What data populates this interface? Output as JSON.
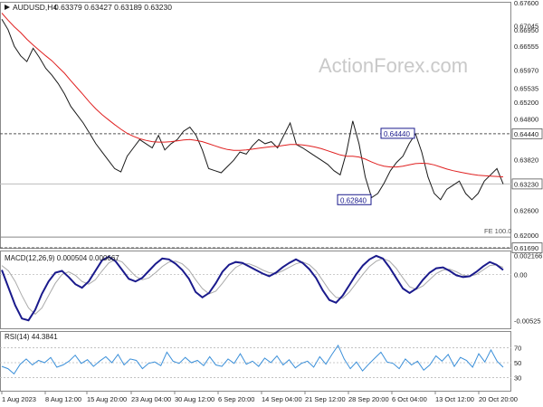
{
  "chart_data": {
    "type": "line",
    "symbol": "AUDUSD,H4",
    "ohlc_header": [
      "0.63379",
      "0.63427",
      "0.63189",
      "0.63230"
    ],
    "watermark": "ActionForex.com",
    "x_tick_labels": [
      "1 Aug 2023",
      "8 Aug 12:00",
      "15 Aug 20:00",
      "23 Aug 04:00",
      "30 Aug 12:00",
      "6 Sep 20:00",
      "14 Sep 04:00",
      "21 Sep 12:00",
      "28 Sep 20:00",
      "6 Oct 04:00",
      "13 Oct 12:00",
      "20 Oct 20:00"
    ],
    "price_panel": {
      "ylim": [
        0.6169,
        0.676
      ],
      "y_tick_labels": [
        "0.67600",
        "0.67045",
        "0.66950",
        "0.66555",
        "0.65970",
        "0.65535",
        "0.65200",
        "0.64800",
        "0.64440",
        "0.63820",
        "0.63230",
        "0.62600",
        "0.62000",
        "0.61690"
      ],
      "price_series_values": [
        0.672,
        0.6695,
        0.6655,
        0.6632,
        0.6618,
        0.665,
        0.6628,
        0.6602,
        0.6585,
        0.6565,
        0.654,
        0.651,
        0.649,
        0.647,
        0.6445,
        0.642,
        0.64,
        0.638,
        0.636,
        0.6352,
        0.639,
        0.641,
        0.643,
        0.642,
        0.641,
        0.644,
        0.6405,
        0.642,
        0.643,
        0.645,
        0.646,
        0.644,
        0.6405,
        0.636,
        0.6355,
        0.635,
        0.6365,
        0.638,
        0.64,
        0.6395,
        0.6415,
        0.643,
        0.642,
        0.6425,
        0.641,
        0.644,
        0.647,
        0.6418,
        0.641,
        0.64,
        0.639,
        0.638,
        0.637,
        0.6355,
        0.6345,
        0.64,
        0.6475,
        0.642,
        0.634,
        0.629,
        0.63,
        0.6325,
        0.6355,
        0.6375,
        0.639,
        0.642,
        0.6444,
        0.64,
        0.634,
        0.63,
        0.6285,
        0.631,
        0.632,
        0.633,
        0.63,
        0.6285,
        0.63,
        0.633,
        0.6345,
        0.636,
        0.6323
      ],
      "moving_average_values": [
        0.6735,
        0.6718,
        0.6702,
        0.6688,
        0.6672,
        0.6658,
        0.6645,
        0.6632,
        0.662,
        0.6605,
        0.659,
        0.6572,
        0.6555,
        0.6538,
        0.652,
        0.6504,
        0.649,
        0.6478,
        0.6466,
        0.6455,
        0.6445,
        0.6438,
        0.6432,
        0.6428,
        0.6425,
        0.6424,
        0.6424,
        0.6425,
        0.6427,
        0.6429,
        0.643,
        0.6428,
        0.6425,
        0.642,
        0.6415,
        0.641,
        0.6406,
        0.6404,
        0.6404,
        0.6405,
        0.6407,
        0.6409,
        0.6411,
        0.6413,
        0.6414,
        0.6416,
        0.6418,
        0.6418,
        0.6417,
        0.6415,
        0.6412,
        0.6408,
        0.6403,
        0.6398,
        0.6393,
        0.639,
        0.639,
        0.6388,
        0.6383,
        0.6376,
        0.637,
        0.6366,
        0.6364,
        0.6364,
        0.6366,
        0.6369,
        0.6372,
        0.6373,
        0.6372,
        0.6369,
        0.6364,
        0.6359,
        0.6355,
        0.6352,
        0.6349,
        0.6346,
        0.6344,
        0.6343,
        0.6342,
        0.6341,
        0.634
      ],
      "level_labels": [
        {
          "label": "0.64440",
          "price": 0.6444
        },
        {
          "label": "0.62840",
          "price": 0.6284
        }
      ],
      "fib_label": "FE 100.0",
      "fib_price": 0.6195,
      "current_price_label": "0.63230",
      "current_price": 0.6323
    },
    "macd_panel": {
      "title": "MACD(12,26,9) 0.000504 0.000667",
      "ylim": [
        -0.006,
        0.0025
      ],
      "y_tick_labels": [
        "0.002166",
        "0.00",
        "-0.00525"
      ],
      "macd_values": [
        0.0005,
        -0.0015,
        -0.0035,
        -0.005,
        -0.0052,
        -0.004,
        -0.0022,
        -0.0008,
        0.0002,
        0.0004,
        -0.0003,
        -0.0011,
        -0.0015,
        -0.0008,
        0.0004,
        0.0016,
        0.002,
        0.0015,
        0.0005,
        -0.0005,
        -0.0008,
        -0.0004,
        0.0004,
        0.0012,
        0.0018,
        0.0017,
        0.0012,
        0.0005,
        -0.0005,
        -0.002,
        -0.0026,
        -0.0021,
        -0.001,
        0.0003,
        0.0011,
        0.0014,
        0.0013,
        0.0009,
        0.0005,
        0.0001,
        -0.0002,
        0.0002,
        0.0008,
        0.0013,
        0.0017,
        0.0013,
        0.0006,
        -0.0004,
        -0.0018,
        -0.0029,
        -0.0032,
        -0.0024,
        -0.0012,
        0.0,
        0.001,
        0.0017,
        0.0021,
        0.0018,
        0.0008,
        -0.0004,
        -0.0016,
        -0.0021,
        -0.0016,
        -0.0006,
        0.0002,
        0.0007,
        0.0008,
        0.0004,
        -0.0001,
        -0.0003,
        -0.0002,
        0.0003,
        0.0009,
        0.0014,
        0.0011,
        0.0005
      ],
      "signal_values": [
        0.001,
        0.0004,
        -0.0008,
        -0.0024,
        -0.0038,
        -0.0045,
        -0.0038,
        -0.0024,
        -0.001,
        0.0,
        0.0003,
        -0.0001,
        -0.0008,
        -0.0011,
        -0.0006,
        0.0004,
        0.0013,
        0.0017,
        0.0014,
        0.0006,
        -0.0002,
        -0.0006,
        -0.0004,
        0.0002,
        0.0009,
        0.0014,
        0.0015,
        0.0012,
        0.0005,
        -0.0006,
        -0.0016,
        -0.0022,
        -0.0019,
        -0.001,
        0.0,
        0.0008,
        0.0012,
        0.0012,
        0.0009,
        0.0005,
        0.0002,
        0.0001,
        0.0004,
        0.0008,
        0.0012,
        0.0014,
        0.0011,
        0.0004,
        -0.0007,
        -0.0018,
        -0.0026,
        -0.0027,
        -0.002,
        -0.001,
        0.0,
        0.0009,
        0.0015,
        0.0018,
        0.0015,
        0.0007,
        -0.0004,
        -0.0014,
        -0.0017,
        -0.0013,
        -0.0006,
        0.0001,
        0.0005,
        0.0006,
        0.0003,
        -0.0001,
        -0.0002,
        0.0,
        0.0005,
        0.001,
        0.0011,
        0.0008
      ]
    },
    "rsi_panel": {
      "title": "RSI(14) 44.3841",
      "ylim": [
        0,
        100
      ],
      "y_tick_labels": [
        "70",
        "50",
        "30"
      ],
      "guide_levels": [
        70,
        50,
        30
      ],
      "rsi_values": [
        45,
        42,
        35,
        48,
        55,
        47,
        53,
        50,
        57,
        44,
        47,
        52,
        60,
        49,
        54,
        45,
        52,
        58,
        50,
        61,
        47,
        55,
        53,
        42,
        49,
        51,
        46,
        64,
        52,
        49,
        57,
        50,
        53,
        46,
        58,
        47,
        45,
        55,
        49,
        62,
        48,
        52,
        45,
        56,
        50,
        59,
        47,
        54,
        43,
        49,
        52,
        44,
        58,
        48,
        61,
        73,
        55,
        42,
        51,
        39,
        48,
        56,
        64,
        51,
        49,
        42,
        55,
        47,
        52,
        40,
        47,
        59,
        52,
        61,
        45,
        57,
        53,
        44,
        62,
        51,
        67,
        52,
        44
      ]
    },
    "colors": {
      "price_line": "#1a1a1a",
      "moving_average": "#e02020",
      "macd_line": "#1a1a8c",
      "signal_line": "#aaaaaa",
      "rsi_line": "#3a8fd9",
      "guide_dashed": "#888888",
      "label_box": "#1a1a8c",
      "grid_separator": "#888888"
    }
  }
}
